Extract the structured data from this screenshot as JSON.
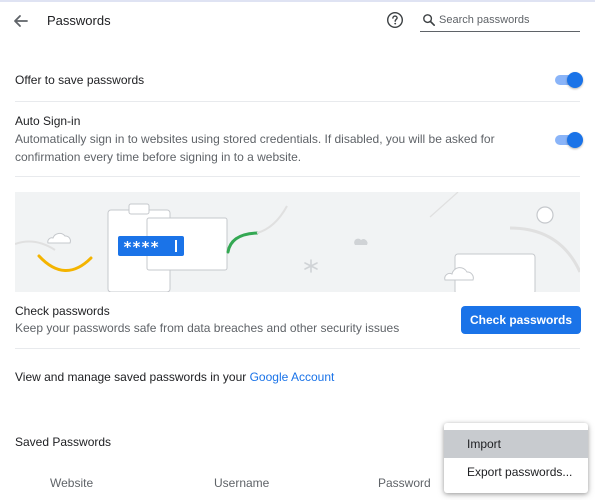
{
  "header": {
    "title": "Passwords",
    "search_placeholder": "Search passwords"
  },
  "offer_save": {
    "label": "Offer to save passwords",
    "enabled": true
  },
  "auto_signin": {
    "label": "Auto Sign-in",
    "description": "Automatically sign in to websites using stored credentials. If disabled, you will be asked for confirmation every time before signing in to a website.",
    "enabled": true
  },
  "illustration": {
    "masked_password": "****"
  },
  "check_passwords": {
    "title": "Check passwords",
    "description": "Keep your passwords safe from data breaches and other security issues",
    "button_label": "Check passwords"
  },
  "account": {
    "text": "View and manage saved passwords in your ",
    "link_text": "Google Account"
  },
  "saved_passwords": {
    "title": "Saved Passwords",
    "columns": [
      "Website",
      "Username",
      "Password"
    ]
  },
  "menu": {
    "items": [
      "Import",
      "Export passwords..."
    ],
    "highlighted_index": 0
  },
  "colors": {
    "accent": "#1a73e8",
    "toggle_track": "#8ab4f8",
    "illustration_bg": "#f1f3f4",
    "menu_highlight": "#c8cbcf"
  },
  "icons": {
    "back": "arrow-back-icon",
    "help": "help-circle-icon",
    "search": "search-icon"
  }
}
